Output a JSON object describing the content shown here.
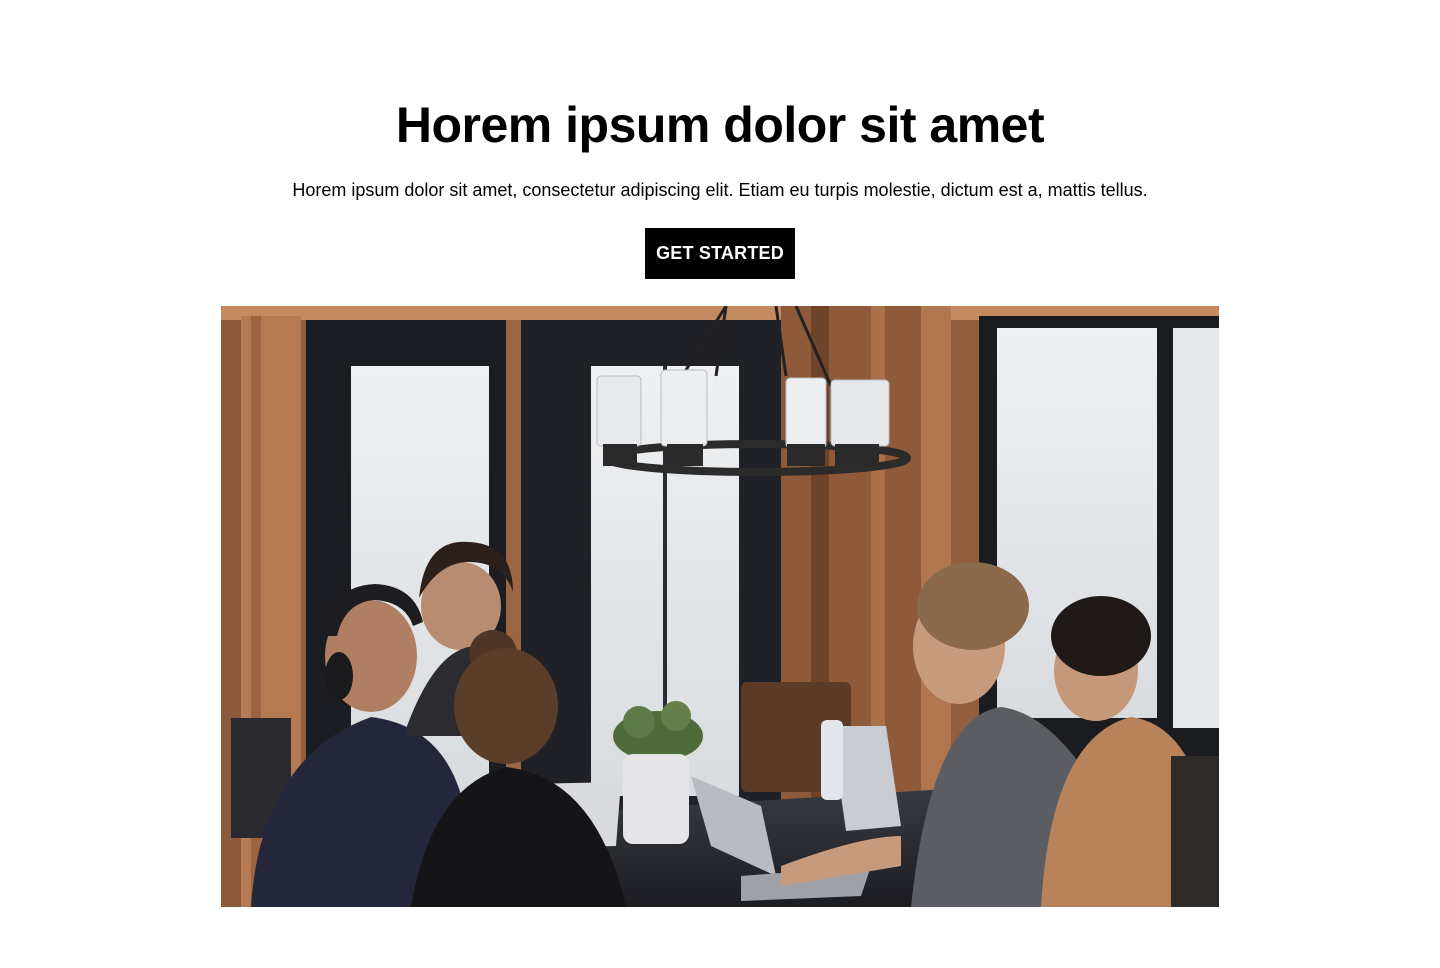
{
  "hero": {
    "title": "Horem ipsum dolor sit amet",
    "subtitle": "Horem ipsum dolor sit amet, consectetur adipiscing elit. Etiam eu turpis molestie, dictum est a, mattis tellus.",
    "cta_label": "GET STARTED",
    "image": {
      "subject": "team-working-at-table-photo"
    }
  },
  "colors": {
    "background": "#ffffff",
    "text": "#000000",
    "button_bg": "#000000",
    "button_text": "#ffffff"
  }
}
